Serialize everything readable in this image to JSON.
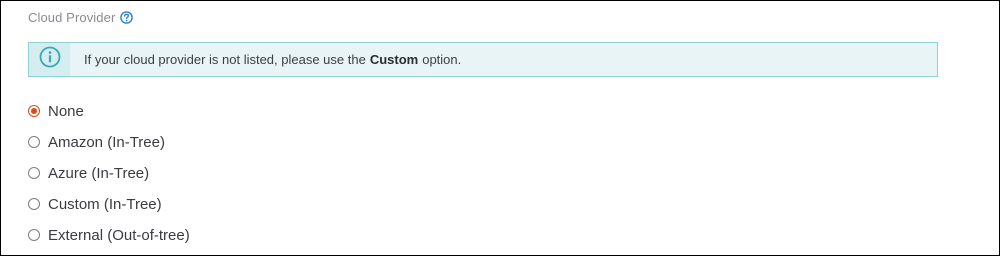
{
  "header": {
    "label": "Cloud Provider",
    "help_icon": "question-circle-icon"
  },
  "banner": {
    "icon": "info-circle-icon",
    "text_before": "If your cloud provider is not listed, please use the",
    "text_bold": "Custom",
    "text_after": "option."
  },
  "radio_options": [
    {
      "label": "None",
      "checked": true
    },
    {
      "label": "Amazon (In-Tree)",
      "checked": false
    },
    {
      "label": "Azure (In-Tree)",
      "checked": false
    },
    {
      "label": "Custom (In-Tree)",
      "checked": false
    },
    {
      "label": "External (Out-of-tree)",
      "checked": false
    }
  ],
  "colors": {
    "accent": "#d84a1b",
    "info_border": "#8fd0d7",
    "info_background": "#e8f4f6",
    "help_icon": "#2f7fd1"
  }
}
